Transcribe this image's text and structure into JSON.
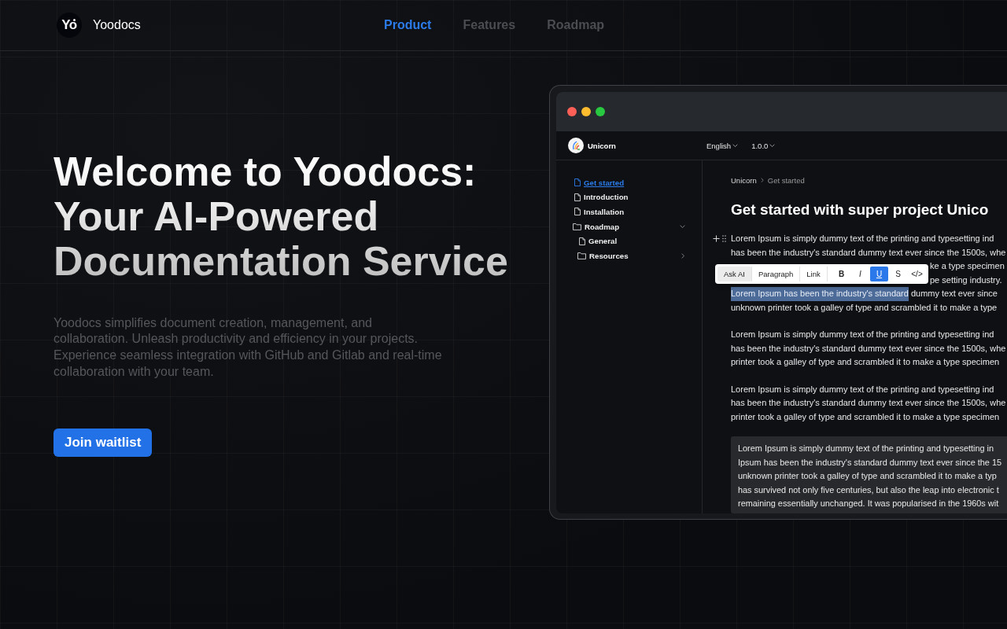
{
  "header": {
    "logo": {
      "text": "Yo"
    },
    "brand": "Yoodocs",
    "nav": [
      {
        "label": "Product",
        "selected": true
      },
      {
        "label": "Features",
        "selected": false
      },
      {
        "label": "Roadmap",
        "selected": false
      }
    ]
  },
  "hero": {
    "title": "Welcome to Yoodocs: Your AI-Powered Documentation Service",
    "description": "Yoodocs simplifies document creation, management, and collaboration. Unleash productivity and efficiency in your projects. Experience seamless integration with GitHub and Gitlab and real-time collaboration with your team.",
    "cta": "Join waitlist"
  },
  "preview": {
    "window_controls": [
      {
        "color": "#fe5f57"
      },
      {
        "color": "#febc2e"
      },
      {
        "color": "#28c840"
      }
    ],
    "project": {
      "name": "Unicorn"
    },
    "selectors": [
      {
        "label": "English"
      },
      {
        "label": "1.0.0"
      }
    ],
    "sidebar": {
      "items": [
        {
          "label": "Get started",
          "kind": "page",
          "selected": true
        },
        {
          "label": "Introduction",
          "kind": "page",
          "selected": false
        },
        {
          "label": "Installation",
          "kind": "page",
          "selected": false
        },
        {
          "label": "Roadmap",
          "kind": "folder",
          "selected": false,
          "expanded": true,
          "children": [
            {
              "label": "General",
              "kind": "page",
              "selected": false
            },
            {
              "label": "Resources",
              "kind": "folder",
              "selected": false,
              "expanded": false
            }
          ]
        }
      ]
    },
    "breadcrumb": [
      {
        "label": "Unicorn",
        "current": false
      },
      {
        "label": "Get started",
        "current": true
      }
    ],
    "heading": "Get started with super project Unico",
    "format_toolbar": [
      {
        "label": "Ask AI",
        "kind": "menu",
        "highlighted": true,
        "active": false
      },
      {
        "label": "Paragraph",
        "kind": "menu",
        "highlighted": false,
        "active": false
      },
      {
        "label": "Link",
        "kind": "menu",
        "highlighted": false,
        "active": false
      },
      {
        "label": "B",
        "kind": "bold",
        "highlighted": false,
        "active": false
      },
      {
        "label": "I",
        "kind": "italic",
        "highlighted": false,
        "active": false
      },
      {
        "label": "U",
        "kind": "underline",
        "highlighted": false,
        "active": true
      },
      {
        "label": "S",
        "kind": "plain",
        "highlighted": false,
        "active": false
      },
      {
        "label": "</>",
        "kind": "plain",
        "highlighted": false,
        "active": false
      }
    ],
    "blocks": [
      {
        "kind": "paragraph",
        "focused": true,
        "lines": [
          {
            "covered": false,
            "parts": [
              {
                "text": "Lorem Ipsum is simply dummy text of the printing and typesetting ind",
                "selected": false
              }
            ]
          },
          {
            "covered": false,
            "parts": [
              {
                "text": "has been the industry's standard dummy text ever since the 1500s, whe",
                "selected": false
              }
            ]
          },
          {
            "covered": true,
            "parts": [
              {
                "text": "ke a type specimen",
                "selected": false
              }
            ]
          },
          {
            "covered": true,
            "parts": [
              {
                "text": "pe setting industry.",
                "selected": false
              }
            ]
          },
          {
            "covered": false,
            "parts": [
              {
                "text": "Lorem Ipsum has been the industry's standard",
                "selected": true
              },
              {
                "text": "dummy text ever since",
                "selected": false
              }
            ]
          },
          {
            "covered": false,
            "parts": [
              {
                "text": "unknown printer took a galley of type and scrambled it to make a type",
                "selected": false
              }
            ]
          }
        ]
      },
      {
        "kind": "paragraph",
        "focused": false,
        "lines": [
          {
            "covered": false,
            "parts": [
              {
                "text": "Lorem Ipsum is simply dummy text of the printing and typesetting ind",
                "selected": false
              }
            ]
          },
          {
            "covered": false,
            "parts": [
              {
                "text": "has been the industry's standard dummy text ever since the 1500s, whe",
                "selected": false
              }
            ]
          },
          {
            "covered": false,
            "parts": [
              {
                "text": "printer took a galley of type and scrambled it to make a type specimen",
                "selected": false
              }
            ]
          }
        ]
      },
      {
        "kind": "paragraph",
        "focused": false,
        "lines": [
          {
            "covered": false,
            "parts": [
              {
                "text": "Lorem Ipsum is simply dummy text of the printing and typesetting ind",
                "selected": false
              }
            ]
          },
          {
            "covered": false,
            "parts": [
              {
                "text": "has been the industry's standard dummy text ever since the 1500s, whe",
                "selected": false
              }
            ]
          },
          {
            "covered": false,
            "parts": [
              {
                "text": "printer took a galley of type and scrambled it to make a type specimen",
                "selected": false
              }
            ]
          }
        ]
      },
      {
        "kind": "quote",
        "focused": false,
        "lines": [
          {
            "covered": false,
            "parts": [
              {
                "text": "Lorem Ipsum is simply dummy text of the printing and typesetting in",
                "selected": false
              }
            ]
          },
          {
            "covered": false,
            "parts": [
              {
                "text": "Ipsum has been the industry's standard dummy text ever since the 15",
                "selected": false
              }
            ]
          },
          {
            "covered": false,
            "parts": [
              {
                "text": "unknown printer took a galley of type and scrambled it to make a typ",
                "selected": false
              }
            ]
          },
          {
            "covered": false,
            "parts": [
              {
                "text": "has survived not only five centuries, but also the leap into electronic t",
                "selected": false
              }
            ]
          },
          {
            "covered": false,
            "parts": [
              {
                "text": "remaining essentially unchanged. It was popularised in the 1960s wit",
                "selected": false
              }
            ]
          }
        ]
      }
    ]
  }
}
